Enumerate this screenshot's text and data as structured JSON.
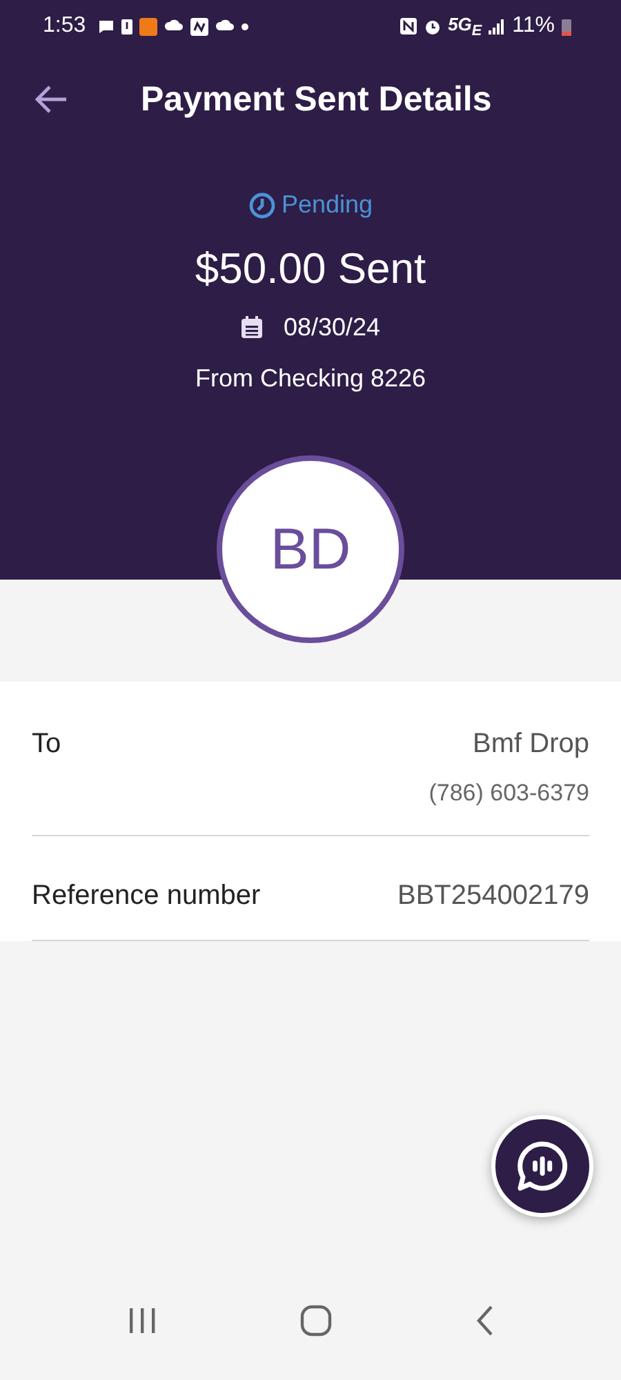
{
  "status_bar": {
    "time": "1:53",
    "network": "5G$_{E}$",
    "battery": "11%"
  },
  "header": {
    "title": "Payment Sent Details"
  },
  "payment": {
    "status": "Pending",
    "amount": "$50.00 Sent",
    "date": "08/30/24",
    "source": "From Checking 8226",
    "initials": "BD"
  },
  "details": [
    {
      "label": "To",
      "value": "Bmf Drop",
      "subvalue": "(786) 603-6379"
    },
    {
      "label": "Reference number",
      "value": "BBT254002179"
    }
  ]
}
